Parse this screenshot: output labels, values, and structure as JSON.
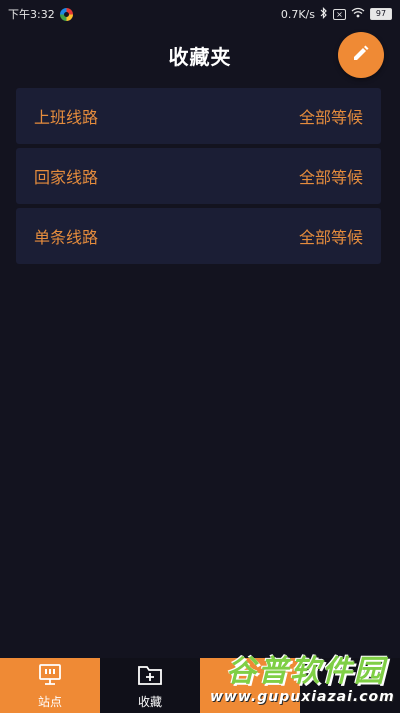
{
  "status_bar": {
    "time": "下午3:32",
    "network_speed": "0.7K/s",
    "battery_level": "97"
  },
  "header": {
    "title": "收藏夹"
  },
  "routes": [
    {
      "name": "上班线路",
      "action": "全部等候"
    },
    {
      "name": "回家线路",
      "action": "全部等候"
    },
    {
      "name": "单条线路",
      "action": "全部等候"
    }
  ],
  "tabs": [
    {
      "label": "站点",
      "icon": "bus-stop-icon",
      "active": true
    },
    {
      "label": "收藏",
      "icon": "folder-add-icon",
      "active": false
    },
    {
      "label": "",
      "icon": "",
      "active": true
    },
    {
      "label": "",
      "icon": "",
      "active": false
    }
  ],
  "watermark": {
    "brand": "谷普软件园",
    "url": "www.gupuxiazai.com"
  },
  "colors": {
    "background": "#13131f",
    "card": "#1b1e35",
    "accent": "#ef8a35",
    "text_accent": "#e58c3d"
  }
}
